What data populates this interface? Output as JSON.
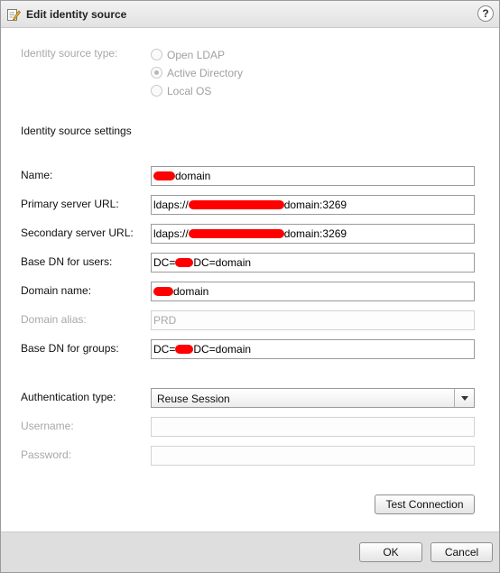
{
  "dialog": {
    "title": "Edit identity source",
    "help_label": "?"
  },
  "source_type": {
    "label": "Identity source type:",
    "options": [
      "Open LDAP",
      "Active Directory",
      "Local OS"
    ],
    "selected": "Active Directory"
  },
  "settings": {
    "section_title": "Identity source settings",
    "name_label": "Name:",
    "name_value": "domain",
    "primary_label": "Primary server URL:",
    "primary_prefix": "ldaps://",
    "primary_suffix": "domain:3269",
    "secondary_label": "Secondary server URL:",
    "secondary_prefix": "ldaps://",
    "secondary_suffix": "domain:3269",
    "base_dn_users_label": "Base DN for users:",
    "base_dn_users_prefix": "DC=",
    "base_dn_users_suffix": "DC=domain",
    "domain_name_label": "Domain name:",
    "domain_name_value": "domain",
    "domain_alias_label": "Domain alias:",
    "domain_alias_value": "PRD",
    "base_dn_groups_label": "Base DN for groups:",
    "base_dn_groups_prefix": "DC=",
    "base_dn_groups_suffix": "DC=domain"
  },
  "auth": {
    "type_label": "Authentication type:",
    "type_value": "Reuse Session",
    "username_label": "Username:",
    "password_label": "Password:"
  },
  "buttons": {
    "test_connection": "Test Connection",
    "ok": "OK",
    "cancel": "Cancel"
  },
  "colors": {
    "redaction": "#ff0000",
    "footer_bg": "#dedede"
  },
  "icons": {
    "title_icon": "edit-document-icon",
    "help_icon": "help-icon",
    "dropdown_icon": "chevron-down-icon"
  }
}
